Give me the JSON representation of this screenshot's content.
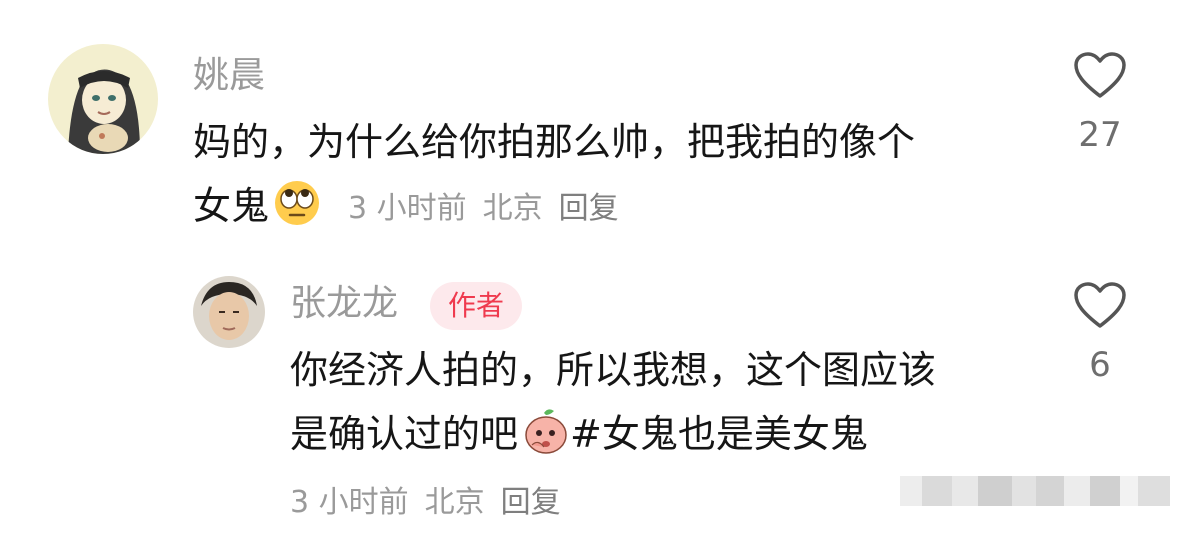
{
  "comments": [
    {
      "username": "姚晨",
      "line1": "妈的，为什么给你拍那么帅，把我拍的像个",
      "line2": "女鬼",
      "emoji": "eye-roll-emoji",
      "time": "3 小时前",
      "location": "北京",
      "reply_label": "回复",
      "likes": "27"
    },
    {
      "username": "张龙龙",
      "badge": "作者",
      "line1": "你经济人拍的，所以我想，这个图应该",
      "line2a": "是确认过的吧",
      "emoji": "peach-thinking-emoji",
      "line2b": "#女鬼也是美女鬼",
      "time": "3 小时前",
      "location": "北京",
      "reply_label": "回复",
      "likes": "6"
    }
  ],
  "colors": {
    "text": "#161616",
    "meta": "#9a9a9a",
    "badge_text": "#ef3a4e",
    "badge_bg": "#fde9ec"
  }
}
